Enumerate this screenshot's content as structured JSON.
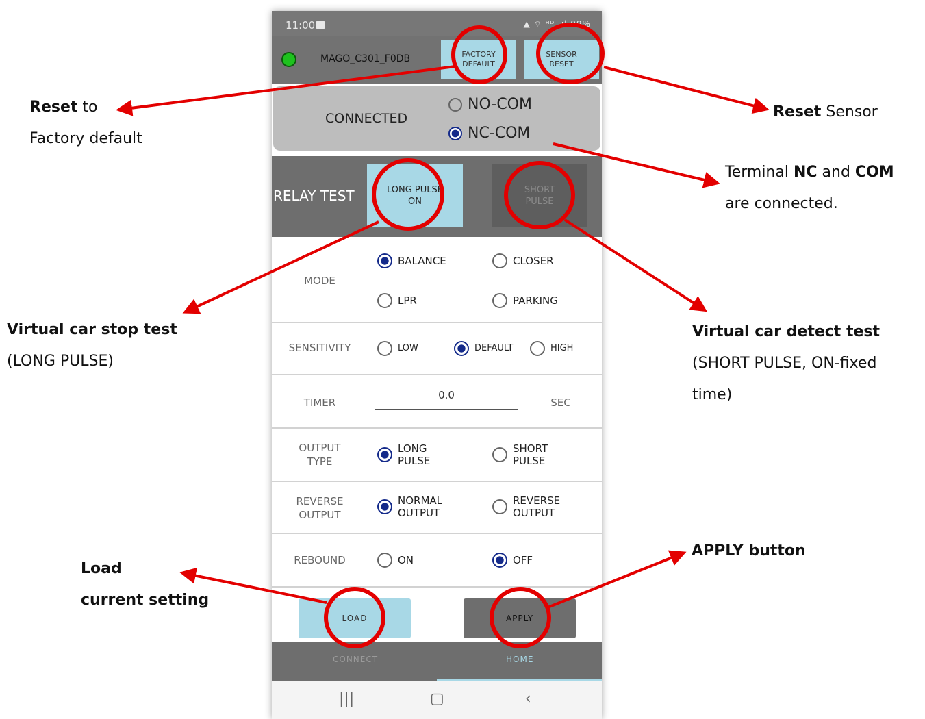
{
  "status_bar": {
    "time": "11:00",
    "system_icons": "▲ ⌔ ᴴᴰ .ıl 99%"
  },
  "title_bar": {
    "device_name": "MAGO_C301_F0DB",
    "factory_default_label": "FACTORY\nDEFAULT",
    "sensor_reset_label": "SENSOR\nRESET"
  },
  "connection": {
    "label": "CONNECTED",
    "options": [
      "NO-COM",
      "NC-COM"
    ],
    "selected": "NC-COM"
  },
  "relay_test": {
    "label": "RELAY TEST",
    "long_pulse_label": "LONG PULSE\nON",
    "short_pulse_label": "SHORT\nPULSE"
  },
  "settings": {
    "mode": {
      "label": "MODE",
      "options": [
        "BALANCE",
        "CLOSER",
        "LPR",
        "PARKING"
      ],
      "selected": "BALANCE"
    },
    "sensitivity": {
      "label": "SENSITIVITY",
      "options": [
        "LOW",
        "DEFAULT",
        "HIGH"
      ],
      "selected": "DEFAULT"
    },
    "timer": {
      "label": "TIMER",
      "value": "0.0",
      "unit": "SEC"
    },
    "output_type": {
      "label": "OUTPUT\nTYPE",
      "options": [
        "LONG\nPULSE",
        "SHORT\nPULSE"
      ],
      "selected": "LONG\nPULSE"
    },
    "reverse_output": {
      "label": "REVERSE\nOUTPUT",
      "options": [
        "NORMAL\nOUTPUT",
        "REVERSE\nOUTPUT"
      ],
      "selected": "NORMAL\nOUTPUT"
    },
    "rebound": {
      "label": "REBOUND",
      "options": [
        "ON",
        "OFF"
      ],
      "selected": "OFF"
    }
  },
  "actions": {
    "load_label": "LOAD",
    "apply_label": "APPLY"
  },
  "bottom_nav": {
    "tabs": [
      "CONNECT",
      "HOME"
    ],
    "active": "HOME"
  },
  "system_nav": {
    "recents": "|||",
    "home": "▢",
    "back": "‹"
  },
  "annotations": {
    "factory": {
      "bold": "Reset",
      "text1": " to",
      "text2": "Factory default"
    },
    "sensor": {
      "bold": "Reset",
      "text": " Sensor"
    },
    "terminal": {
      "text1": "Terminal ",
      "bold1": "NC",
      "text2": " and ",
      "bold2": "COM",
      "text3": "are connected."
    },
    "stop_test": {
      "bold": "Virtual car stop test",
      "text": "(LONG PULSE)"
    },
    "detect_test": {
      "bold": "Virtual car detect test",
      "text1": "(SHORT PULSE, ON-fixed",
      "text2": "time)"
    },
    "load": {
      "bold1": "Load",
      "bold2": "current setting"
    },
    "apply": {
      "bold": "APPLY button"
    }
  },
  "colors": {
    "highlight_red": "#e30000",
    "button_blue": "#a8d8e6",
    "radio_selected": "#142a8a",
    "led_green": "#1ec21e"
  }
}
